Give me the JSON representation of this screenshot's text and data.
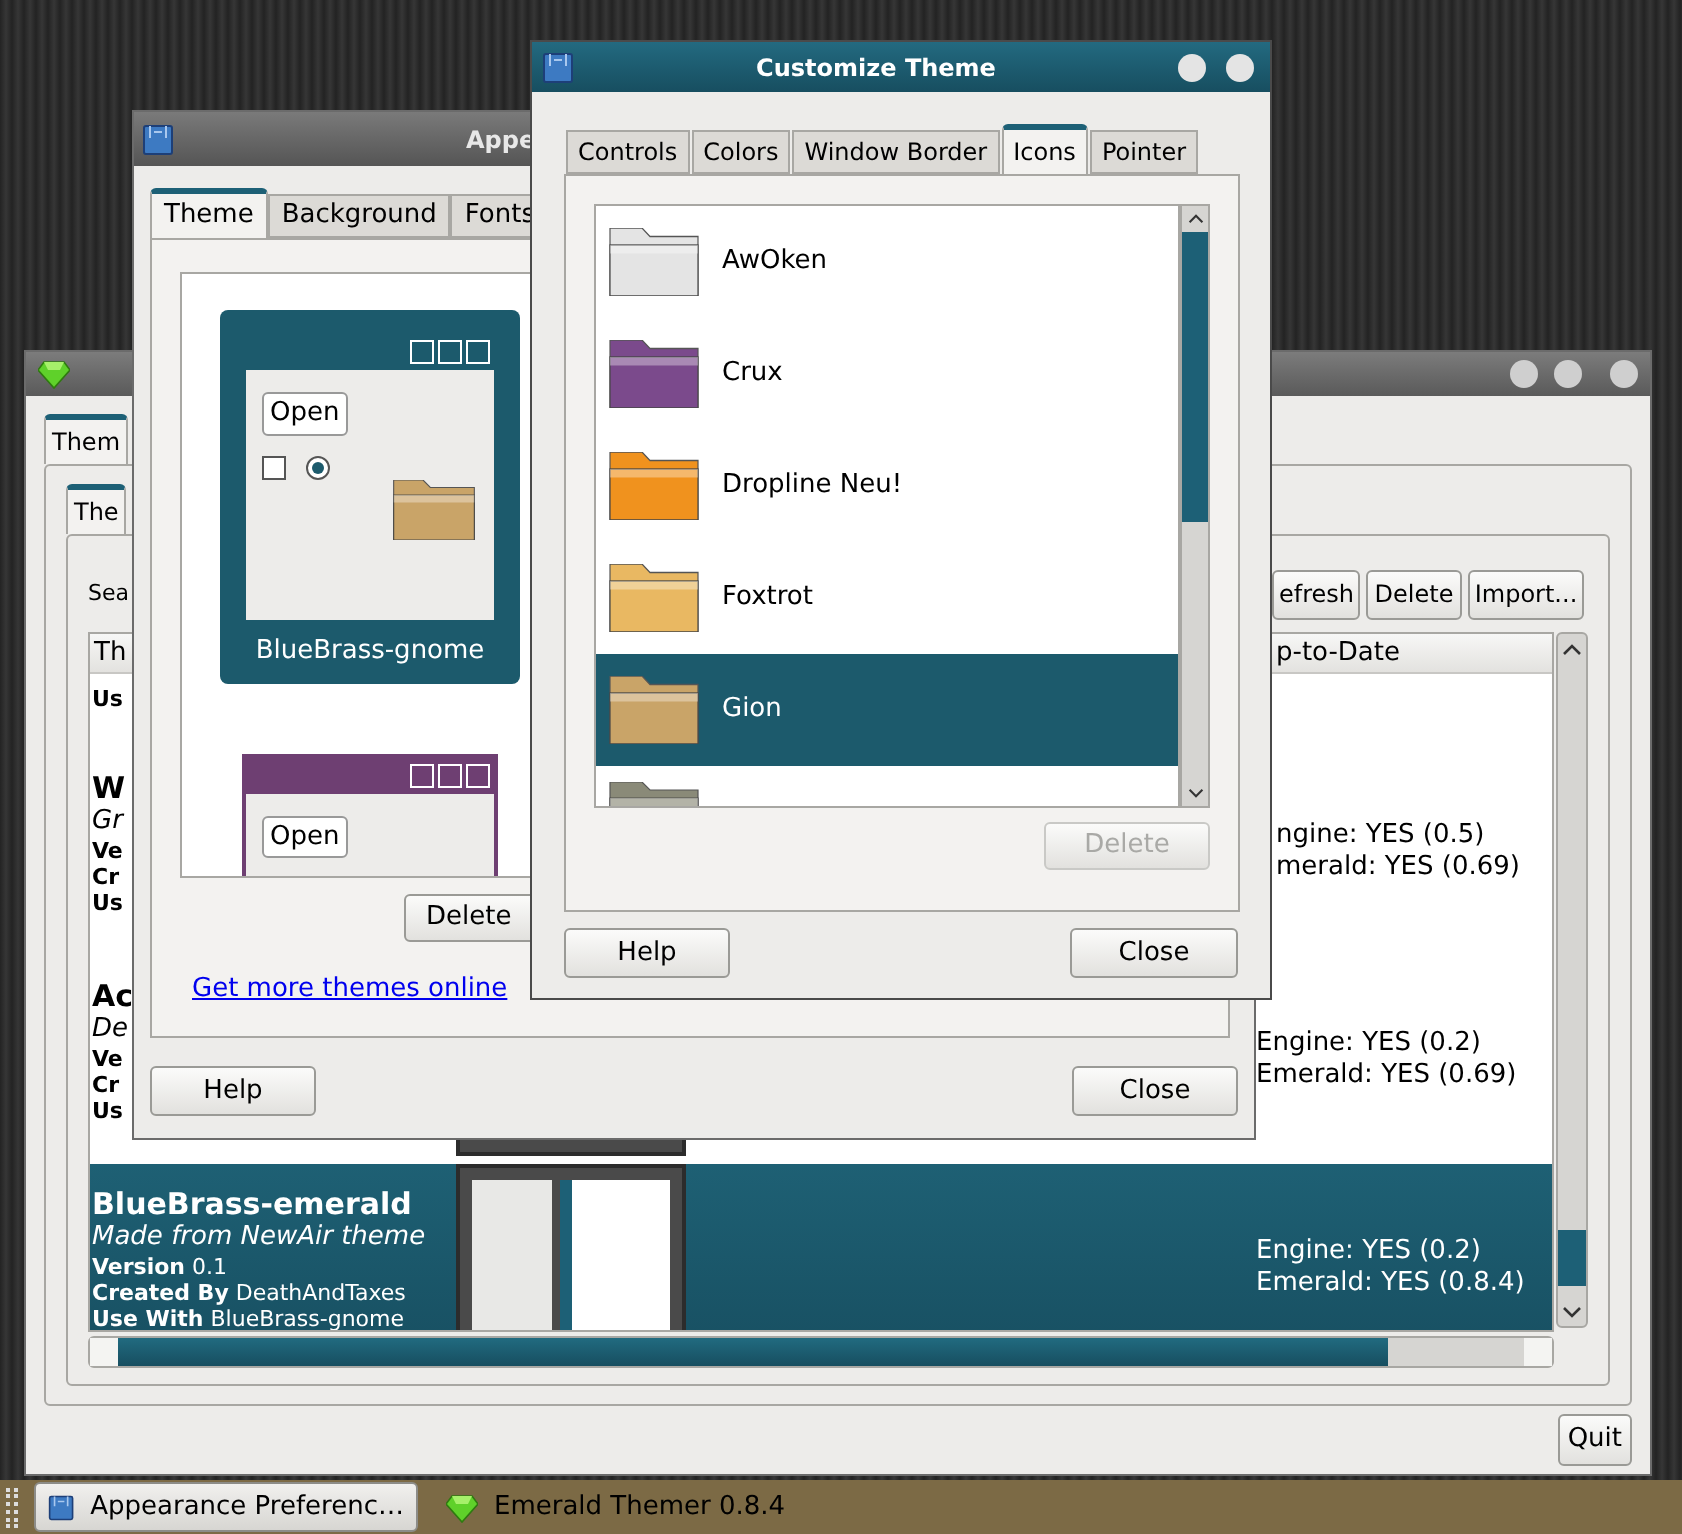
{
  "emerald_window": {
    "tabs": [
      {
        "label": "Them",
        "selected": true
      }
    ],
    "inner_tabs": [
      {
        "label": "The",
        "selected": true
      }
    ],
    "search_label": "Sea",
    "buttons": [
      "efresh",
      "Delete",
      "Import..."
    ],
    "columns": [
      "Th",
      "p-to-Date"
    ],
    "rows": [
      {
        "selected": false,
        "lines": [
          {
            "kind": "field",
            "label": "Us"
          }
        ],
        "status": [],
        "thumbnail": false
      },
      {
        "selected": false,
        "status_hidden_in_part": true,
        "lines": [
          {
            "kind": "name",
            "text": "W"
          },
          {
            "kind": "description",
            "text": "Gr"
          },
          {
            "kind": "field",
            "label": "Ve"
          },
          {
            "kind": "field",
            "label": "Cr"
          },
          {
            "kind": "field",
            "label": "Us"
          }
        ],
        "status": [
          "ngine: YES (0.5)",
          "merald: YES (0.69)"
        ],
        "thumbnail": false
      },
      {
        "selected": false,
        "status_hidden_in_part": false,
        "lines": [
          {
            "kind": "name",
            "text": "Ac"
          },
          {
            "kind": "description",
            "text": "De"
          },
          {
            "kind": "field",
            "label": "Ve"
          },
          {
            "kind": "field",
            "label": "Cr"
          },
          {
            "kind": "field",
            "label": "Us"
          }
        ],
        "status": [
          "Engine: YES (0.2)",
          "Emerald: YES (0.69)"
        ],
        "thumbnail": true
      },
      {
        "selected": true,
        "status_hidden_in_part": false,
        "lines": [
          {
            "kind": "name",
            "text": "BlueBrass-emerald"
          },
          {
            "kind": "description",
            "text": "Made from NewAir theme"
          },
          {
            "kind": "field",
            "label": "Version",
            "value": "0.1"
          },
          {
            "kind": "field",
            "label": "Created By",
            "value": "DeathAndTaxes"
          },
          {
            "kind": "field",
            "label": "Use With",
            "value": "BlueBrass-gnome"
          }
        ],
        "status": [
          "Engine: YES (0.2)",
          "Emerald: YES (0.8.4)"
        ],
        "thumbnail": true
      }
    ],
    "quit": "Quit"
  },
  "appearance_window": {
    "title": "Appe",
    "tabs": [
      {
        "label": "Theme",
        "selected": true
      },
      {
        "label": "Background",
        "selected": false
      },
      {
        "label": "Fonts",
        "selected": false
      }
    ],
    "themes": [
      {
        "name": "BlueBrass-gnome",
        "selected": true,
        "preview_button": "Open",
        "color": "#1c5a6c"
      },
      {
        "selected": false,
        "preview_button": "Open",
        "color": "#6e3f72"
      }
    ],
    "delete": "Delete",
    "link": "Get more themes online",
    "help": "Help",
    "close": "Close"
  },
  "customize_window": {
    "title": "Customize Theme",
    "tabs": [
      {
        "label": "Controls",
        "selected": false
      },
      {
        "label": "Colors",
        "selected": false
      },
      {
        "label": "Window Border",
        "selected": false
      },
      {
        "label": "Icons",
        "selected": true
      },
      {
        "label": "Pointer",
        "selected": false
      }
    ],
    "icon_themes": [
      {
        "name": "AwOken",
        "selected": false,
        "color": "#e4e4e4"
      },
      {
        "name": "Crux",
        "selected": false,
        "color": "#7b4a8c"
      },
      {
        "name": "Dropline Neu!",
        "selected": false,
        "color": "#f0921e"
      },
      {
        "name": "Foxtrot",
        "selected": false,
        "color": "#e9b862"
      },
      {
        "name": "Gion",
        "selected": true,
        "color": "#c9a468"
      },
      {
        "selected": false,
        "color": "#8a8a78"
      }
    ],
    "delete": {
      "label": "Delete",
      "disabled": true
    },
    "help": "Help",
    "close": "Close"
  },
  "taskbar": {
    "items": [
      {
        "label": "Appearance Preferenc…",
        "selected": true,
        "kind": "appearance"
      },
      {
        "label": "Emerald Themer 0.8.4",
        "selected": false,
        "kind": "emerald"
      }
    ]
  }
}
